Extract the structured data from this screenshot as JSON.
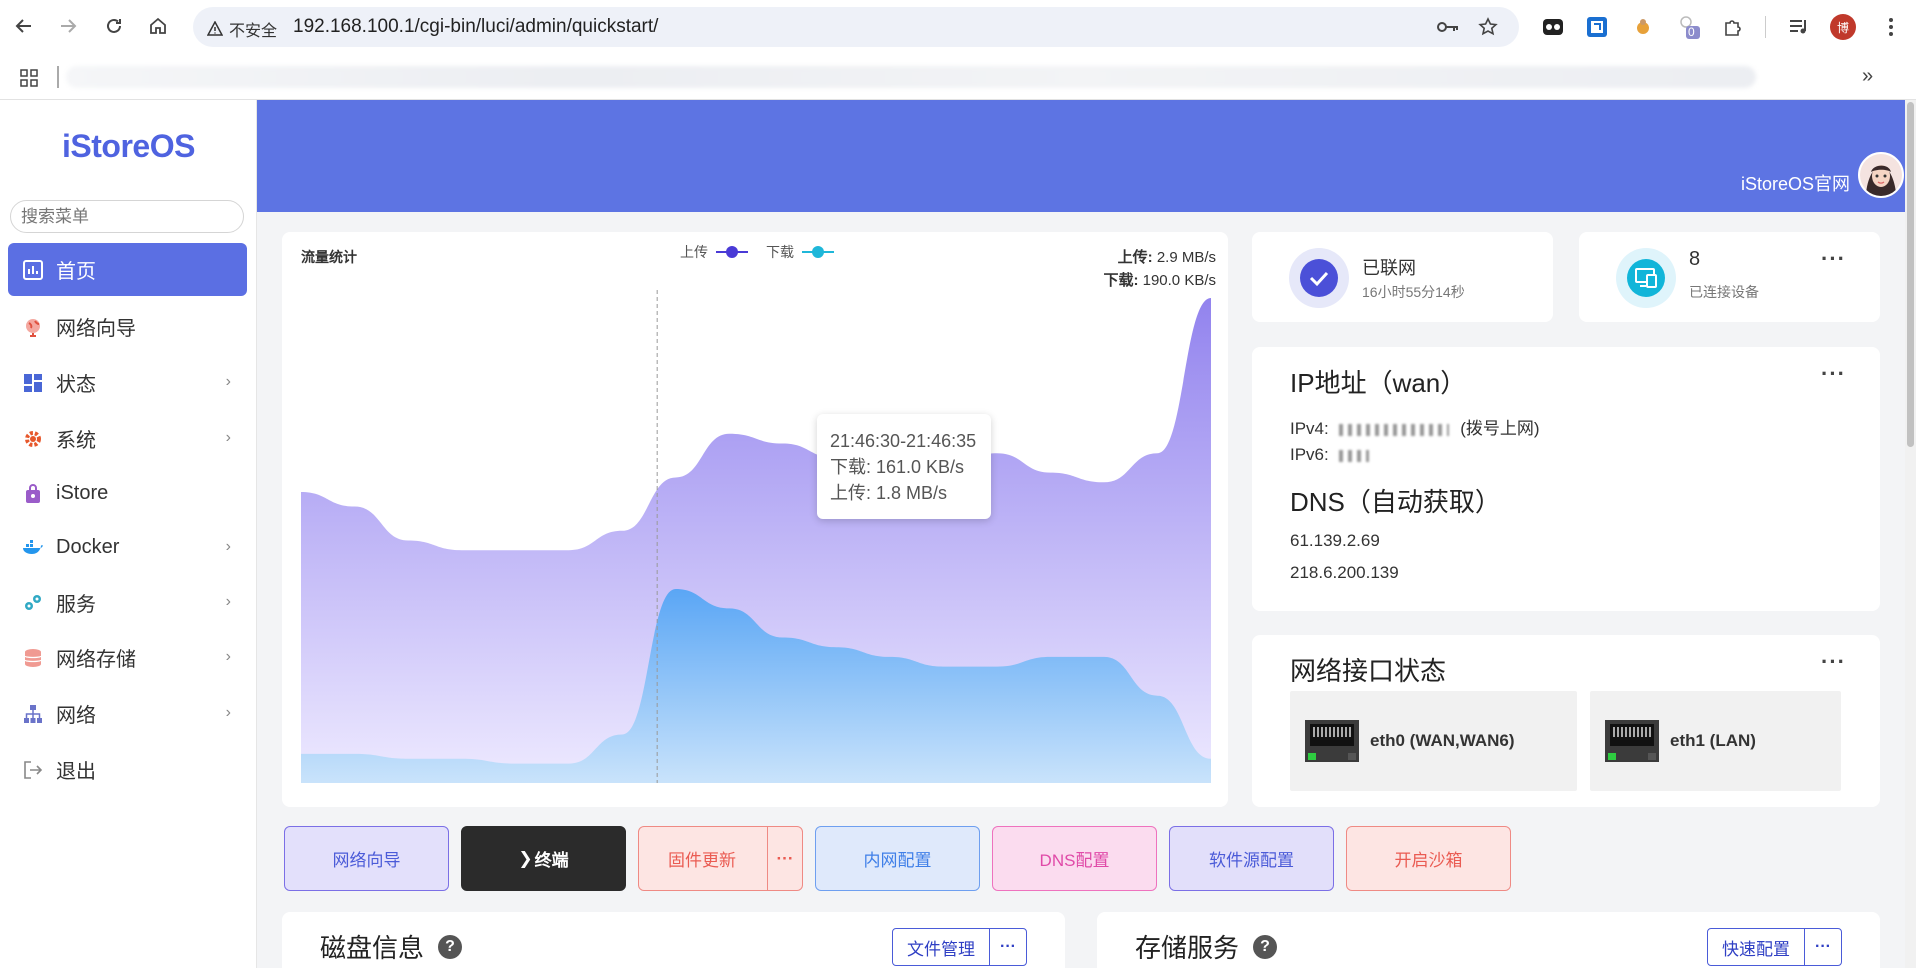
{
  "browser": {
    "security_label": "不安全",
    "url": "192.168.100.1/cgi-bin/luci/admin/quickstart/",
    "extension_badge": "0",
    "profile_initial": "博"
  },
  "sidebar": {
    "logo": "iStoreOS",
    "search_placeholder": "搜索菜单",
    "items": [
      {
        "label": "首页",
        "icon": "dashboard-icon",
        "active": true
      },
      {
        "label": "网络向导",
        "icon": "globe-icon"
      },
      {
        "label": "状态",
        "icon": "grid-icon",
        "has_children": true
      },
      {
        "label": "系统",
        "icon": "gear-icon",
        "has_children": true
      },
      {
        "label": "iStore",
        "icon": "bag-icon"
      },
      {
        "label": "Docker",
        "icon": "docker-icon",
        "has_children": true
      },
      {
        "label": "服务",
        "icon": "services-icon",
        "has_children": true
      },
      {
        "label": "网络存储",
        "icon": "database-icon",
        "has_children": true
      },
      {
        "label": "网络",
        "icon": "network-icon",
        "has_children": true
      },
      {
        "label": "退出",
        "icon": "logout-icon"
      }
    ]
  },
  "banner": {
    "link_text": "iStoreOS官网"
  },
  "traffic": {
    "title": "流量统计",
    "legend_upload": "上传",
    "legend_download": "下载",
    "rate_upload_label": "上传:",
    "rate_upload_value": "2.9 MB/s",
    "rate_download_label": "下载:",
    "rate_download_value": "190.0 KB/s",
    "tooltip": {
      "time": "21:46:30-21:46:35",
      "download": "下载: 161.0 KB/s",
      "upload": "上传: 1.8 MB/s"
    }
  },
  "chart_data": {
    "type": "area",
    "title": "流量统计",
    "series": [
      {
        "name": "上传",
        "values": [
          0.6,
          0.57,
          0.5,
          0.48,
          0.48,
          0.48,
          0.52,
          0.63,
          0.72,
          0.7,
          0.67,
          0.66,
          0.65,
          0.68,
          0.64,
          0.62,
          0.68,
          1.0
        ],
        "color": "#9a8af0"
      },
      {
        "name": "下载",
        "values": [
          0.06,
          0.06,
          0.05,
          0.05,
          0.04,
          0.04,
          0.1,
          0.4,
          0.36,
          0.3,
          0.28,
          0.26,
          0.24,
          0.24,
          0.26,
          0.26,
          0.18,
          0.05
        ],
        "color": "#6ab2f5"
      }
    ],
    "hover_index": 6,
    "grid": false
  },
  "status": {
    "network_label": "已联网",
    "uptime": "16小时55分14秒",
    "device_count": "8",
    "device_label": "已连接设备"
  },
  "ip": {
    "title": "IP地址（wan）",
    "ipv4_label": "IPv4:",
    "ipv4_suffix": "(拨号上网)",
    "ipv6_label": "IPv6:",
    "dns_title": "DNS（自动获取）",
    "dns": [
      "61.139.2.69",
      "218.6.200.139"
    ]
  },
  "interfaces": {
    "title": "网络接口状态",
    "ports": [
      {
        "name": "eth0 (WAN,WAN6)"
      },
      {
        "name": "eth1 (LAN)"
      }
    ]
  },
  "quick_buttons": [
    {
      "label": "网络向导",
      "bg": "#e3e0fb",
      "border": "#7b6fe6",
      "color": "#4b5bd8"
    },
    {
      "label": "终端",
      "bg": "#2b2b2b",
      "border": "#2b2b2b",
      "color": "#ffffff"
    },
    {
      "label": "固件更新",
      "bg": "#fde5e3",
      "border": "#ef8a84",
      "color": "#ea5b52"
    },
    {
      "label": "内网配置",
      "bg": "#dfe9fb",
      "border": "#6e9ff0",
      "color": "#3f7fe8"
    },
    {
      "label": "DNS配置",
      "bg": "#fbdcef",
      "border": "#ee72be",
      "color": "#e04aa8"
    },
    {
      "label": "软件源配置",
      "bg": "#e2dffa",
      "border": "#7b6fe6",
      "color": "#4b5bd8"
    },
    {
      "label": "开启沙箱",
      "bg": "#fde5e3",
      "border": "#ef8a84",
      "color": "#ea5b52"
    }
  ],
  "disk": {
    "title": "磁盘信息",
    "action": "文件管理"
  },
  "storage": {
    "title": "存储服务",
    "action": "快速配置"
  }
}
